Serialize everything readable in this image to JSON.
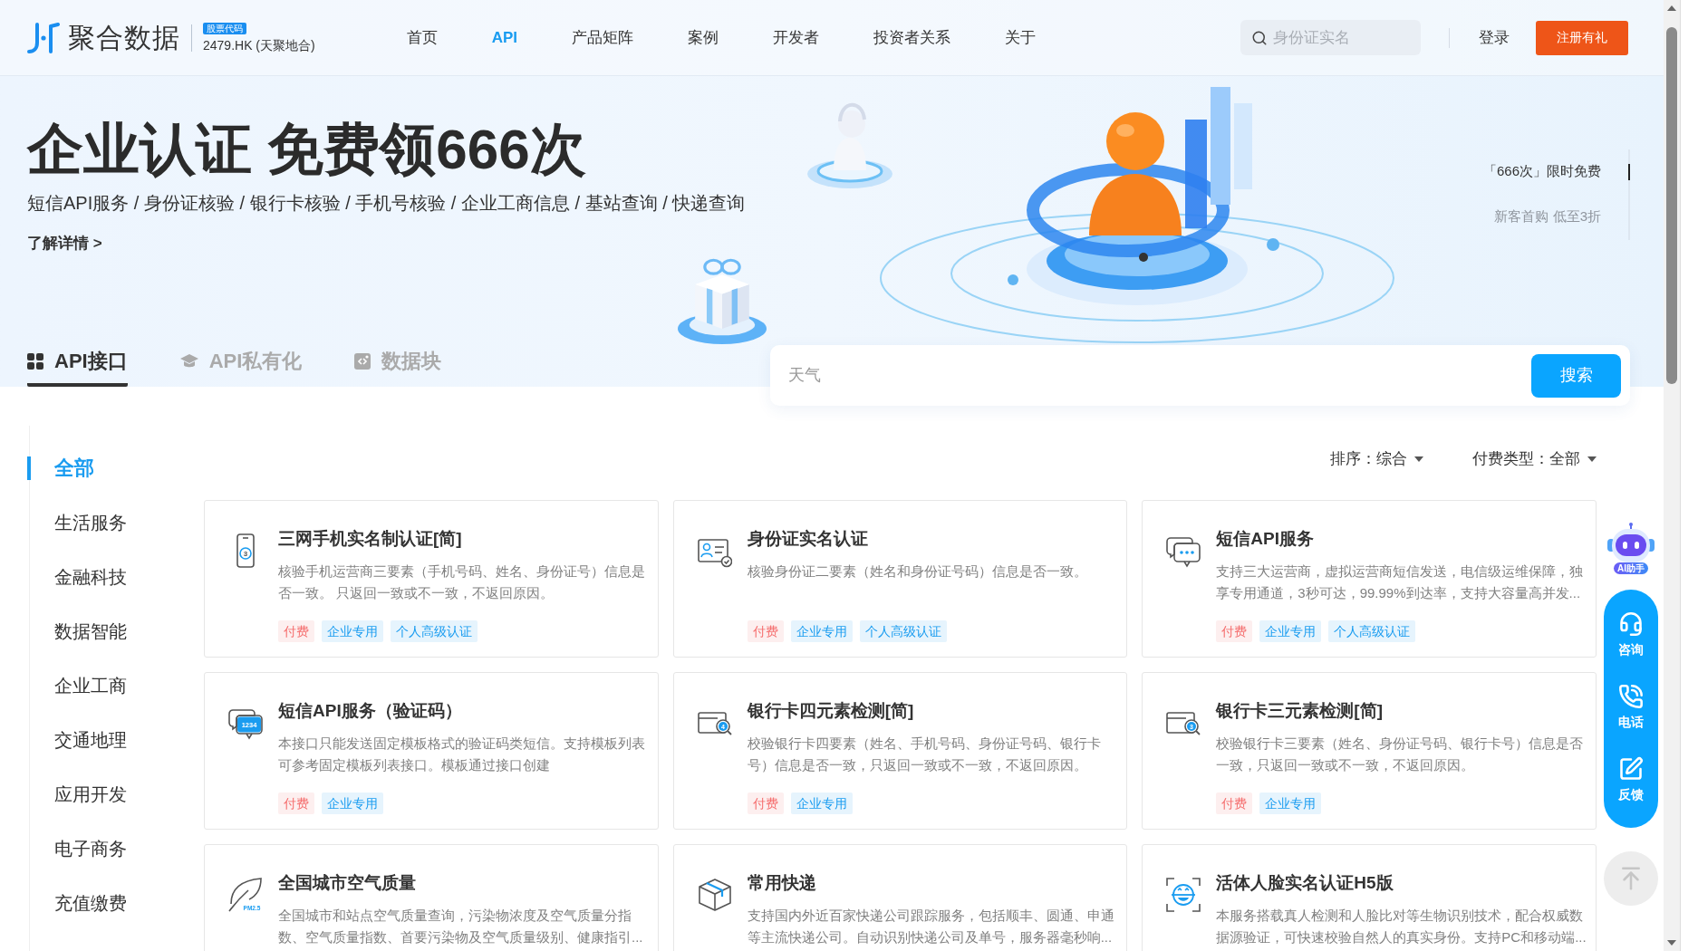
{
  "header": {
    "logo_text": "聚合数据",
    "stock_badge": "股票代码",
    "stock_code": "2479.HK (天聚地合)",
    "nav": [
      {
        "label": "首页",
        "selected": false
      },
      {
        "label": "API",
        "selected": true
      },
      {
        "label": "产品矩阵",
        "selected": false
      },
      {
        "label": "案例",
        "selected": false
      },
      {
        "label": "开发者",
        "selected": false
      },
      {
        "label": "投资者关系",
        "selected": false
      },
      {
        "label": "关于",
        "selected": false
      }
    ],
    "search": {
      "placeholder": "身份证实名"
    },
    "login": "登录",
    "register": "注册有礼"
  },
  "hero": {
    "title": "企业认证 免费领666次",
    "subtitle": "短信API服务 / 身份证核验 / 银行卡核验 / 手机号核验 / 企业工商信息 / 基站查询 / 快递查询",
    "link": "了解详情 >",
    "promo": {
      "title": "「666次」限时免费",
      "subtitle": "新客首购 低至3折"
    }
  },
  "tabs": [
    {
      "label": "API接口",
      "selected": true,
      "kind": "grid"
    },
    {
      "label": "API私有化",
      "selected": false,
      "kind": "cap"
    },
    {
      "label": "数据块",
      "selected": false,
      "kind": "block"
    }
  ],
  "search": {
    "placeholder": "天气",
    "button": "搜索"
  },
  "categories": [
    {
      "label": "全部",
      "selected": true
    },
    {
      "label": "生活服务",
      "selected": false
    },
    {
      "label": "金融科技",
      "selected": false
    },
    {
      "label": "数据智能",
      "selected": false
    },
    {
      "label": "企业工商",
      "selected": false
    },
    {
      "label": "交通地理",
      "selected": false
    },
    {
      "label": "应用开发",
      "selected": false
    },
    {
      "label": "电子商务",
      "selected": false
    },
    {
      "label": "充值缴费",
      "selected": false
    }
  ],
  "filters": [
    {
      "label": "排序：综合"
    },
    {
      "label": "付费类型：全部"
    }
  ],
  "cards": [
    {
      "title": "三网手机实名制认证[简]",
      "description": "核验手机运营商三要素（手机号码、姓名、身份证号）信息是否一致。 只返回一致或不一致，不返回原因。",
      "kind": "phone",
      "icon_text": "3",
      "tags": [
        {
          "label": "付费",
          "kind": "fee"
        },
        {
          "label": "企业专用",
          "kind": "label"
        },
        {
          "label": "个人高级认证",
          "kind": "label"
        }
      ]
    },
    {
      "title": "身份证实名认证",
      "description": "核验身份证二要素（姓名和身份证号码）信息是否一致。",
      "kind": "id-card",
      "tags": [
        {
          "label": "付费",
          "kind": "fee"
        },
        {
          "label": "企业专用",
          "kind": "label"
        },
        {
          "label": "个人高级认证",
          "kind": "label"
        }
      ]
    },
    {
      "title": "短信API服务",
      "description": "支持三大运营商，虚拟运营商短信发送，电信级运维保障，独享专用通道，3秒可达，99.99%到达率，支持大容量高并发...",
      "kind": "chat",
      "tags": [
        {
          "label": "付费",
          "kind": "fee"
        },
        {
          "label": "企业专用",
          "kind": "label"
        },
        {
          "label": "个人高级认证",
          "kind": "label"
        }
      ]
    },
    {
      "title": "短信API服务（验证码）",
      "description": "本接口只能发送固定模板格式的验证码类短信。支持模板列表可参考固定模板列表接口。模板通过接口创建",
      "kind": "sms-code",
      "icon_text": "1234",
      "tags": [
        {
          "label": "付费",
          "kind": "fee"
        },
        {
          "label": "企业专用",
          "kind": "label"
        }
      ]
    },
    {
      "title": "银行卡四元素检测[简]",
      "description": "校验银行卡四要素（姓名、手机号码、身份证号码、银行卡号）信息是否一致，只返回一致或不一致，不返回原因。",
      "kind": "bank-card",
      "icon_text": "4",
      "tags": [
        {
          "label": "付费",
          "kind": "fee"
        },
        {
          "label": "企业专用",
          "kind": "label"
        }
      ]
    },
    {
      "title": "银行卡三元素检测[简]",
      "description": "校验银行卡三要素（姓名、身份证号码、银行卡号）信息是否一致，只返回一致或不一致，不返回原因。",
      "kind": "bank-card",
      "icon_text": "3",
      "tags": [
        {
          "label": "付费",
          "kind": "fee"
        },
        {
          "label": "企业专用",
          "kind": "label"
        }
      ]
    },
    {
      "title": "全国城市空气质量",
      "description": "全国城市和站点空气质量查询，污染物浓度及空气质量分指数、空气质量指数、首要污染物及空气质量级别、健康指引...",
      "kind": "leaf",
      "icon_text": "PM2.5"
    },
    {
      "title": "常用快递",
      "description": "支持国内外近百家快递公司跟踪服务，包括顺丰、圆通、申通等主流快递公司。自动识别快递公司及单号，服务器毫秒响...",
      "kind": "package"
    },
    {
      "title": "活体人脸实名认证H5版",
      "description": "本服务搭载真人检测和人脸比对等生物识别技术，配合权威数据源验证，可快速校验自然人的真实身份。支持PC和移动端...",
      "kind": "face-scan"
    }
  ],
  "assistant": {
    "label": "AI助手"
  },
  "float_actions": [
    {
      "label": "咨询",
      "kind": "consult"
    },
    {
      "label": "电话",
      "kind": "phone"
    },
    {
      "label": "反馈",
      "kind": "feedback"
    }
  ]
}
